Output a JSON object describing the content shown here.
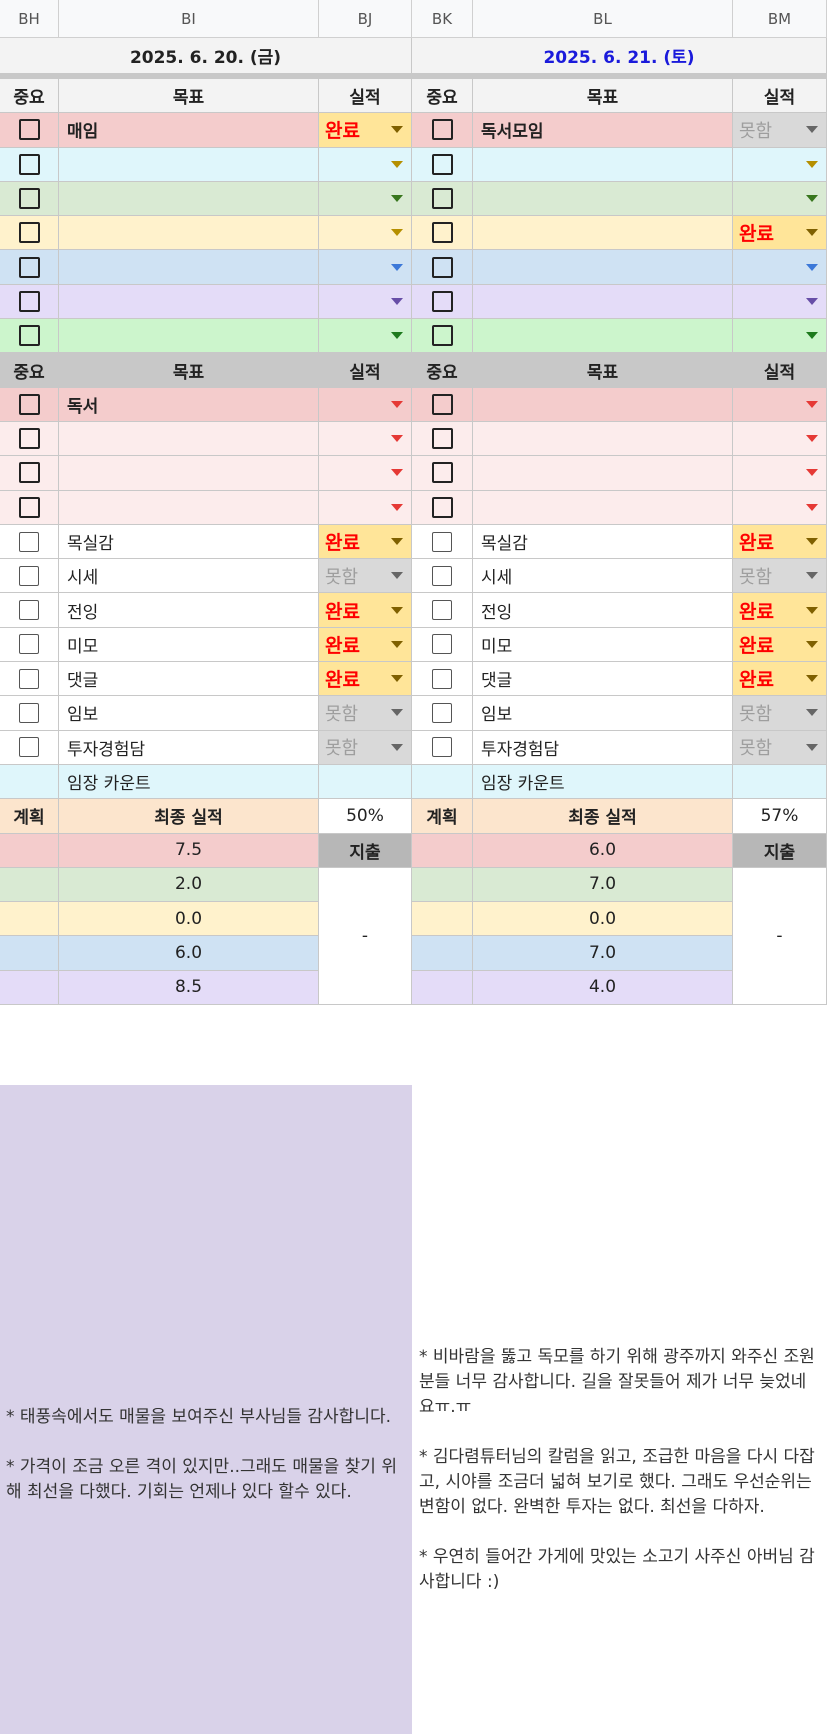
{
  "columns": [
    "BH",
    "BI",
    "BJ",
    "BK",
    "BL",
    "BM"
  ],
  "days": [
    {
      "date": "2025. 6. 20. (금)",
      "date_color": "#222222"
    },
    {
      "date": "2025. 6. 21. (토)",
      "date_color": "#1a1adb"
    }
  ],
  "headers": {
    "important": "중요",
    "goal": "목표",
    "result": "실적"
  },
  "status_labels": {
    "done": "완료",
    "fail": "못함"
  },
  "colors": {
    "pink": "#f4cccc",
    "cyan": "#dff6fb",
    "green": "#d9ead3",
    "yellow": "#fff2cc",
    "blue": "#cfe2f3",
    "lavender": "#e4dcf8",
    "lightgreen": "#ccf5cc",
    "lightpink": "#fcecec",
    "arrow_yellow": "#b58f00",
    "arrow_green": "#38761d",
    "arrow_blue": "#3c78d8",
    "arrow_purple": "#674ea7",
    "arrow_lightgreen": "#1d7a1d",
    "arrow_red": "#e53935"
  },
  "section1": [
    {
      "bg": "pink",
      "arrow": "arrow_yellow",
      "left": {
        "goal": "매임",
        "status": "done"
      },
      "right": {
        "goal": "독서모임",
        "status": "fail"
      }
    },
    {
      "bg": "cyan",
      "arrow": "arrow_yellow",
      "left": {
        "goal": "",
        "status": ""
      },
      "right": {
        "goal": "",
        "status": ""
      }
    },
    {
      "bg": "green",
      "arrow": "arrow_green",
      "left": {
        "goal": "",
        "status": ""
      },
      "right": {
        "goal": "",
        "status": ""
      }
    },
    {
      "bg": "yellow",
      "arrow": "arrow_yellow",
      "left": {
        "goal": "",
        "status": ""
      },
      "right": {
        "goal": "",
        "status": "done"
      }
    },
    {
      "bg": "blue",
      "arrow": "arrow_blue",
      "left": {
        "goal": "",
        "status": ""
      },
      "right": {
        "goal": "",
        "status": ""
      }
    },
    {
      "bg": "lavender",
      "arrow": "arrow_purple",
      "left": {
        "goal": "",
        "status": ""
      },
      "right": {
        "goal": "",
        "status": ""
      }
    },
    {
      "bg": "lightgreen",
      "arrow": "arrow_lightgreen",
      "left": {
        "goal": "",
        "status": ""
      },
      "right": {
        "goal": "",
        "status": ""
      }
    }
  ],
  "section2": [
    {
      "bg": "pink",
      "left": {
        "goal": "독서"
      },
      "right": {
        "goal": ""
      }
    },
    {
      "bg": "lightpink",
      "left": {
        "goal": ""
      },
      "right": {
        "goal": ""
      }
    },
    {
      "bg": "lightpink",
      "left": {
        "goal": ""
      },
      "right": {
        "goal": ""
      }
    },
    {
      "bg": "lightpink",
      "left": {
        "goal": ""
      },
      "right": {
        "goal": ""
      }
    }
  ],
  "habits": [
    {
      "name": "목실감",
      "left": "done",
      "right": "done"
    },
    {
      "name": "시세",
      "left": "fail",
      "right": "fail"
    },
    {
      "name": "전잉",
      "left": "done",
      "right": "done"
    },
    {
      "name": "미모",
      "left": "done",
      "right": "done"
    },
    {
      "name": "댓글",
      "left": "done",
      "right": "done"
    },
    {
      "name": "임보",
      "left": "fail",
      "right": "fail"
    },
    {
      "name": "투자경험담",
      "left": "fail",
      "right": "fail"
    }
  ],
  "imjang_label": "임장 카운트",
  "plan_label": "계획",
  "final_label": "최종 실적",
  "percent": {
    "left": "50%",
    "right": "57%"
  },
  "expense_label": "지출",
  "expense_value": "-",
  "scores": {
    "left": [
      "7.5",
      "2.0",
      "0.0",
      "6.0",
      "8.5"
    ],
    "right": [
      "6.0",
      "7.0",
      "0.0",
      "7.0",
      "4.0"
    ],
    "bgs": [
      "pink",
      "green",
      "yellow",
      "blue",
      "lavender"
    ]
  },
  "notes": {
    "left": "* 태풍속에서도 매물을 보여주신 부사님들 감사합니다.\n\n* 가격이 조금 오른 격이 있지만..그래도 매물을 찾기 위해 최선을 다했다. 기회는 언제나 있다 할수 있다.",
    "right": "* 비바람을 뚫고 독모를 하기 위해 광주까지 와주신 조원분들 너무 감사합니다. 길을 잘못들어 제가 너무 늦었네요ㅠ.ㅠ\n\n* 김다렴튜터님의 칼럼을 읽고, 조급한 마음을 다시 다잡고, 시야를 조금더 넓혀 보기로 했다. 그래도 우선순위는 변함이 없다. 완벽한 투자는 없다. 최선을 다하자.\n\n* 우연히 들어간 가게에 맛있는 소고기 사주신 아버님 감사합니다 :)"
  }
}
